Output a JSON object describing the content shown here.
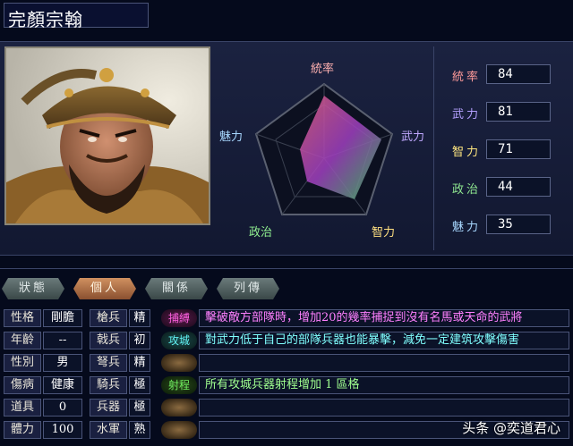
{
  "header": {
    "name": "完顏宗翰"
  },
  "radar": {
    "labels": {
      "top": "統率",
      "right": "武力",
      "bottom_right": "智力",
      "bottom_left": "政治",
      "left": "魅力"
    }
  },
  "stats": [
    {
      "label": "統率",
      "value": "84",
      "color": "#ff9a9a"
    },
    {
      "label": "武力",
      "value": "81",
      "color": "#b4a0ff"
    },
    {
      "label": "智力",
      "value": "71",
      "color": "#ffe680"
    },
    {
      "label": "政治",
      "value": "44",
      "color": "#8fe890"
    },
    {
      "label": "魅力",
      "value": "35",
      "color": "#a8d8ff"
    }
  ],
  "tabs": [
    {
      "label": "狀態",
      "active": false
    },
    {
      "label": "個人",
      "active": true
    },
    {
      "label": "關係",
      "active": false
    },
    {
      "label": "列傳",
      "active": false
    }
  ],
  "personal": [
    {
      "label": "性格",
      "value": "剛膽"
    },
    {
      "label": "年齡",
      "value": "--"
    },
    {
      "label": "性別",
      "value": "男"
    },
    {
      "label": "傷病",
      "value": "健康"
    },
    {
      "label": "道具",
      "value": "0"
    },
    {
      "label": "體力",
      "value": "100"
    }
  ],
  "troops": [
    {
      "label": "槍兵",
      "value": "精"
    },
    {
      "label": "戟兵",
      "value": "初"
    },
    {
      "label": "弩兵",
      "value": "精"
    },
    {
      "label": "騎兵",
      "value": "極"
    },
    {
      "label": "兵器",
      "value": "極"
    },
    {
      "label": "水軍",
      "value": "熟"
    }
  ],
  "skills": [
    {
      "name": "捕縛",
      "desc": "擊破敵方部隊時，增加20的幾率捕捉到沒有名馬或天命的武將",
      "badge_color": "#ff40d0",
      "text_color": "#ff80ff"
    },
    {
      "name": "攻城",
      "desc": "對武力低于自己的部隊兵器也能暴擊，減免一定建筑攻擊傷害",
      "badge_color": "#40e0e0",
      "text_color": "#80ffff"
    },
    {
      "name": "",
      "desc": "",
      "badge_color": "#8a6a40",
      "text_color": "#ffffff"
    },
    {
      "name": "射程",
      "desc": "所有攻城兵器射程增加 1 區格",
      "badge_color": "#60e060",
      "text_color": "#a0ff90"
    },
    {
      "name": "",
      "desc": "",
      "badge_color": "#8a6a40",
      "text_color": "#ffffff"
    },
    {
      "name": "",
      "desc": "",
      "badge_color": "#8a6a40",
      "text_color": "#ffffff"
    }
  ],
  "watermark": "头条 @奕道君心"
}
